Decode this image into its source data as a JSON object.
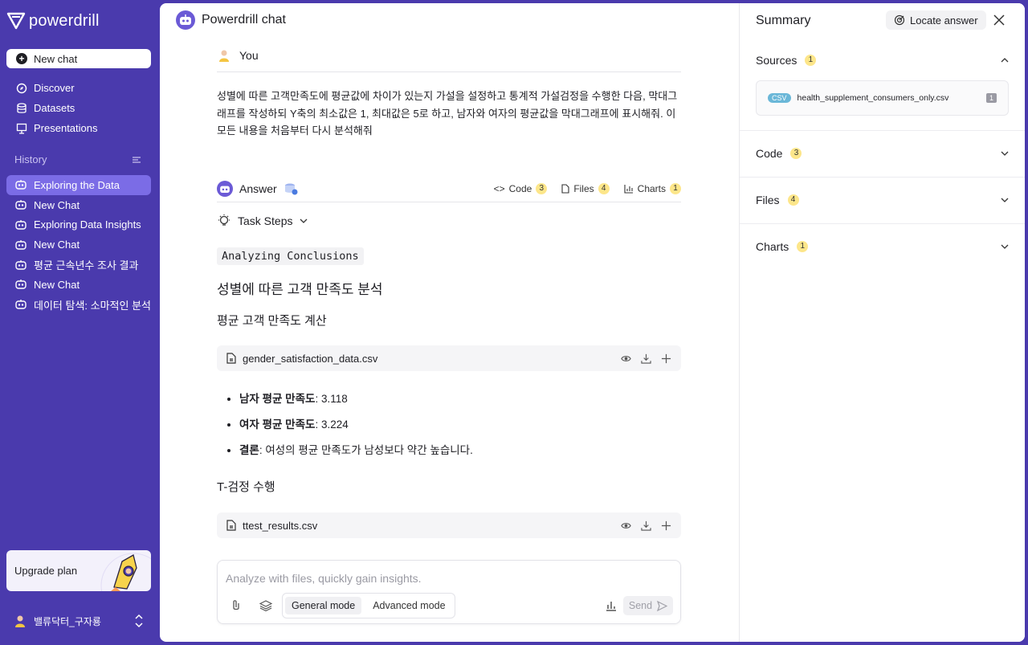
{
  "app": {
    "name": "powerdrill"
  },
  "sidebar": {
    "new_chat": "New chat",
    "nav": [
      {
        "label": "Discover",
        "icon": "discover-icon"
      },
      {
        "label": "Datasets",
        "icon": "database-icon"
      },
      {
        "label": "Presentations",
        "icon": "presentation-icon"
      }
    ],
    "history_label": "History",
    "history": [
      "Exploring the Data",
      "New Chat",
      "Exploring Data Insights",
      "New Chat",
      "평균 근속년수 조사 결과",
      "New Chat",
      "데이터 탐색: 소마적인 분석"
    ],
    "upgrade": "Upgrade plan",
    "user": "밸류닥터_구자룡"
  },
  "chat": {
    "title": "Powerdrill chat",
    "you_label": "You",
    "question": "성별에 따른 고객만족도에 평균값에 차이가 있는지 가설을 설정하고 통계적 가설검정을 수행한 다음, 막대그래프를 작성하되 Y축의 최소값은 1, 최대값은 5로 하고, 남자와 여자의 평균값을 막대그래프에 표시해줘. 이 모든 내용을 처음부터 다시 분석해줘",
    "answer_label": "Answer",
    "tabs": [
      {
        "label": "Code",
        "count": "3"
      },
      {
        "label": "Files",
        "count": "4"
      },
      {
        "label": "Charts",
        "count": "1"
      }
    ],
    "task_steps": "Task Steps",
    "step_tag": "Analyzing Conclusions",
    "heading": "성별에 따른 고객 만족도 분석",
    "subheading1": "평균 고객 만족도 계산",
    "file1": "gender_satisfaction_data.csv",
    "bullets": [
      {
        "bold": "남자 평균 만족도",
        "text": ": 3.118"
      },
      {
        "bold": "여자 평균 만족도",
        "text": ": 3.224"
      },
      {
        "bold": "결론",
        "text": ": 여성의 평균 만족도가 남성보다 약간 높습니다."
      }
    ],
    "subheading2": "T-검정 수행",
    "file2": "ttest_results.csv"
  },
  "composer": {
    "placeholder": "Analyze with files, quickly gain insights.",
    "mode_general": "General mode",
    "mode_advanced": "Advanced mode",
    "send": "Send"
  },
  "summary": {
    "title": "Summary",
    "locate": "Locate answer",
    "sections": [
      {
        "label": "Sources",
        "count": "1"
      },
      {
        "label": "Code",
        "count": "3"
      },
      {
        "label": "Files",
        "count": "4"
      },
      {
        "label": "Charts",
        "count": "1"
      }
    ],
    "source_file": {
      "type": "CSV",
      "name": "health_supplement_consumers_only.csv",
      "ref": "1"
    }
  },
  "colors": {
    "sidebar": "#4a3aad",
    "active_item": "#7b6ce6",
    "badge": "#fde68a"
  }
}
